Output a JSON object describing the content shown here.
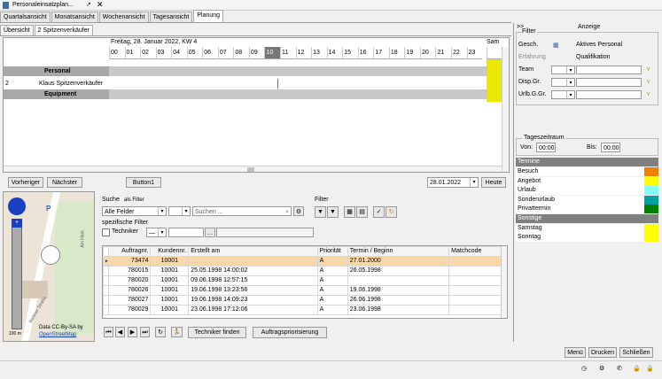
{
  "app": {
    "title": "Personaleinsatzplan...",
    "close": "✕",
    "popout": "↗"
  },
  "tabs": [
    "Quartalsansicht",
    "Monatsansicht",
    "Wochenansicht",
    "Tagesansicht",
    "Planung"
  ],
  "subtabs": [
    "Übersicht",
    "2 Spitzenverkäufer"
  ],
  "grid": {
    "date_header": "Freitag, 28. Januar 2022, KW 4",
    "hours": [
      "00",
      "01",
      "02",
      "03",
      "04",
      "05",
      "06",
      "07",
      "08",
      "09",
      "10",
      "11",
      "12",
      "13",
      "14",
      "15",
      "16",
      "17",
      "18",
      "19",
      "20",
      "21",
      "22",
      "23"
    ],
    "current_hour": "10",
    "next_col": "Sam",
    "group_personal": "Personal",
    "row_index": "2",
    "row_name": "Klaus Spitzenverkäufer",
    "group_equipment": "Equipment"
  },
  "nav": {
    "prev": "Vorheriger",
    "next": "Nächster",
    "button1": "Button1",
    "date": "28.01.2022",
    "today": "Heute"
  },
  "search": {
    "label": "Suche",
    "filter_label": "als Filter",
    "field_select": "Alle Felder",
    "placeholder": "Suchen ...",
    "spec_filter": "spezifische Filter",
    "techniker": "Techniker",
    "filter_heading": "Filter"
  },
  "orders": {
    "columns": [
      "Auftragnr.",
      "Kundennr.",
      "Erstellt am",
      "Priorität",
      "Termin / Beginn",
      "Matchcode"
    ],
    "rows": [
      [
        "73474",
        "10001",
        "",
        "A",
        "27.01.2000",
        ""
      ],
      [
        "780015",
        "10001",
        "25.05.1998 14:00:02",
        "A",
        "26.05.1998",
        ""
      ],
      [
        "780020",
        "10001",
        "09.06.1998 12:57:15",
        "A",
        "",
        ""
      ],
      [
        "780026",
        "10001",
        "19.06.1998 13:23:56",
        "A",
        "19.06.1998",
        ""
      ],
      [
        "780027",
        "10001",
        "19.06.1998 14:09:23",
        "A",
        "26.06.1998",
        ""
      ],
      [
        "780029",
        "10001",
        "23.06.1998 17:12:06",
        "A",
        "23.06.1998",
        ""
      ]
    ]
  },
  "order_buttons": {
    "find": "Techniker finden",
    "prio": "Auftragspriorisierung"
  },
  "map": {
    "attr1": "Data CC-By-SA by",
    "attr2": "OpenStreetMap",
    "street1": "Am Hain",
    "street2": "Berliner Straße",
    "scale": "100 m"
  },
  "sidebar": {
    "collapse": ">>",
    "heading": "Anzeige",
    "filter": "Filter",
    "gesch": "Gesch.",
    "aktives": "Aktives Personal",
    "erfahrung": "Erfahrung",
    "qualifikation": "Qualifikation",
    "team": "Team",
    "disp": "Disp.Gr.",
    "urlb": "Urlb.G.Gr.",
    "zeitraum": "Tageszeitraum",
    "von": "Von:",
    "von_val": "00:00",
    "bis": "Bis:",
    "bis_val": "00:00"
  },
  "legend": {
    "termine": "Termine",
    "items": [
      {
        "label": "Besuch",
        "color": "#f08000"
      },
      {
        "label": "Angebot",
        "color": "#ffff00"
      },
      {
        "label": "Urlaub",
        "color": "#80ffff"
      },
      {
        "label": "Sonderurlaub",
        "color": "#00a0a0"
      },
      {
        "label": "Privattermin",
        "color": "#008000"
      }
    ],
    "sonstige": "Sonstige",
    "items2": [
      {
        "label": "Samstag",
        "color": "#ffff00"
      },
      {
        "label": "Sonntag",
        "color": "#ffff00"
      }
    ]
  },
  "footer": {
    "menu": "Menü",
    "print": "Drucken",
    "close": "Schließen"
  }
}
